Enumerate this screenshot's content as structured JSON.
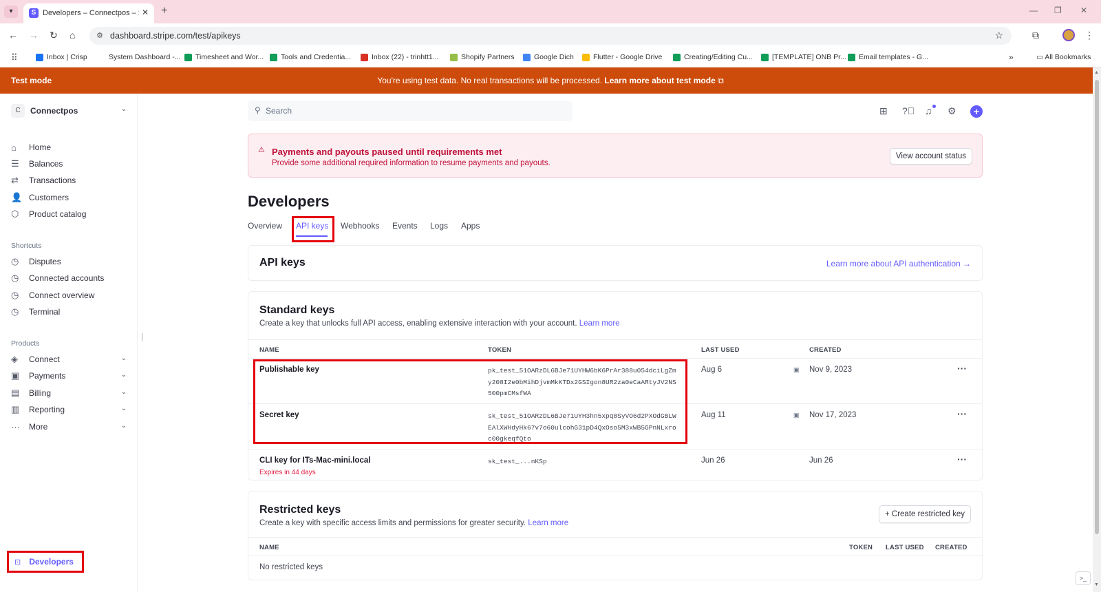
{
  "browser": {
    "tab_title": "Developers – Connectpos – Stri",
    "url": "dashboard.stripe.com/test/apikeys",
    "bookmarks": [
      {
        "label": "Inbox | Crisp",
        "color": "#1972f5"
      },
      {
        "label": "System Dashboard -...",
        "color": "#ffffff"
      },
      {
        "label": "Timesheet and Wor...",
        "color": "#0f9d58"
      },
      {
        "label": "Tools and Credentia...",
        "color": "#0f9d58"
      },
      {
        "label": "Inbox (22) - trinhtt1...",
        "color": "#d93025"
      },
      {
        "label": "Shopify Partners",
        "color": "#95bf47"
      },
      {
        "label": "Google Dich",
        "color": "#4285f4"
      },
      {
        "label": "Flutter - Google Drive",
        "color": "#fbbc04"
      },
      {
        "label": "Creating/Editing Cu...",
        "color": "#0f9d58"
      },
      {
        "label": "[TEMPLATE] ONB Pr...",
        "color": "#0f9d58"
      },
      {
        "label": "Email templates - G...",
        "color": "#0f9d58"
      }
    ],
    "all_bookmarks": "All Bookmarks"
  },
  "banner": {
    "label": "Test mode",
    "message": "You're using test data. No real transactions will be processed.",
    "link": "Learn more about test mode"
  },
  "sidebar": {
    "account_initial": "C",
    "account_name": "Connectpos",
    "items": [
      {
        "label": "Home",
        "icon": "home-icon"
      },
      {
        "label": "Balances",
        "icon": "balances-icon"
      },
      {
        "label": "Transactions",
        "icon": "transactions-icon"
      },
      {
        "label": "Customers",
        "icon": "customers-icon"
      },
      {
        "label": "Product catalog",
        "icon": "product-catalog-icon"
      }
    ],
    "shortcuts_title": "Shortcuts",
    "shortcuts": [
      {
        "label": "Disputes"
      },
      {
        "label": "Connected accounts"
      },
      {
        "label": "Connect overview"
      },
      {
        "label": "Terminal"
      }
    ],
    "products_title": "Products",
    "products": [
      {
        "label": "Connect"
      },
      {
        "label": "Payments"
      },
      {
        "label": "Billing"
      },
      {
        "label": "Reporting"
      },
      {
        "label": "More"
      }
    ],
    "developers": "Developers"
  },
  "search": {
    "placeholder": "Search"
  },
  "alert": {
    "title": "Payments and payouts paused until requirements met",
    "message": "Provide some additional required information to resume payments and payouts.",
    "button": "View account status"
  },
  "page": {
    "title": "Developers",
    "tabs": [
      "Overview",
      "API keys",
      "Webhooks",
      "Events",
      "Logs",
      "Apps"
    ],
    "active_tab": "API keys"
  },
  "api_keys_card": {
    "title": "API keys",
    "link": "Learn more about API authentication →"
  },
  "standard_keys": {
    "title": "Standard keys",
    "subtitle": "Create a key that unlocks full API access, enabling extensive interaction with your account.",
    "learn_more": "Learn more",
    "columns": [
      "NAME",
      "TOKEN",
      "LAST USED",
      "CREATED"
    ],
    "rows": [
      {
        "name": "Publishable key",
        "token": "pk_test_51OARzDL6BJe71UYHW6bK6PrAr388u054dciLgZmy208I2e0bMihDjvmMkKTDx2GSIgon8UR2za0eCaARtyJV2NS500pmCMsfWA",
        "last_used": "Aug 6",
        "created": "Nov 9, 2023",
        "warning": ""
      },
      {
        "name": "Secret key",
        "token": "sk_test_51OARzDL6BJe71UYH3hn5xpq8SyVO6d2PXOdGBLWEAlXWHdyHk67v7o60ulcohG31pD4QxOso5M3xWB5GPnNLxroc00gkeqfQto",
        "last_used": "Aug 11",
        "created": "Nov 17, 2023",
        "warning": ""
      },
      {
        "name": "CLI key for ITs-Mac-mini.local",
        "token": "sk_test_...nKSp",
        "last_used": "Jun 26",
        "created": "Jun 26",
        "warning": "Expires in 44 days"
      }
    ]
  },
  "restricted_keys": {
    "title": "Restricted keys",
    "subtitle": "Create a key with specific access limits and permissions for greater security.",
    "learn_more": "Learn more",
    "button": "Create restricted key",
    "columns": [
      "NAME",
      "TOKEN",
      "LAST USED",
      "CREATED"
    ],
    "empty": "No restricted keys"
  },
  "colors": {
    "accent": "#635bff",
    "test_banner": "#cd4c0b",
    "alert_text": "#c0123c",
    "highlight": "#e3000b"
  }
}
